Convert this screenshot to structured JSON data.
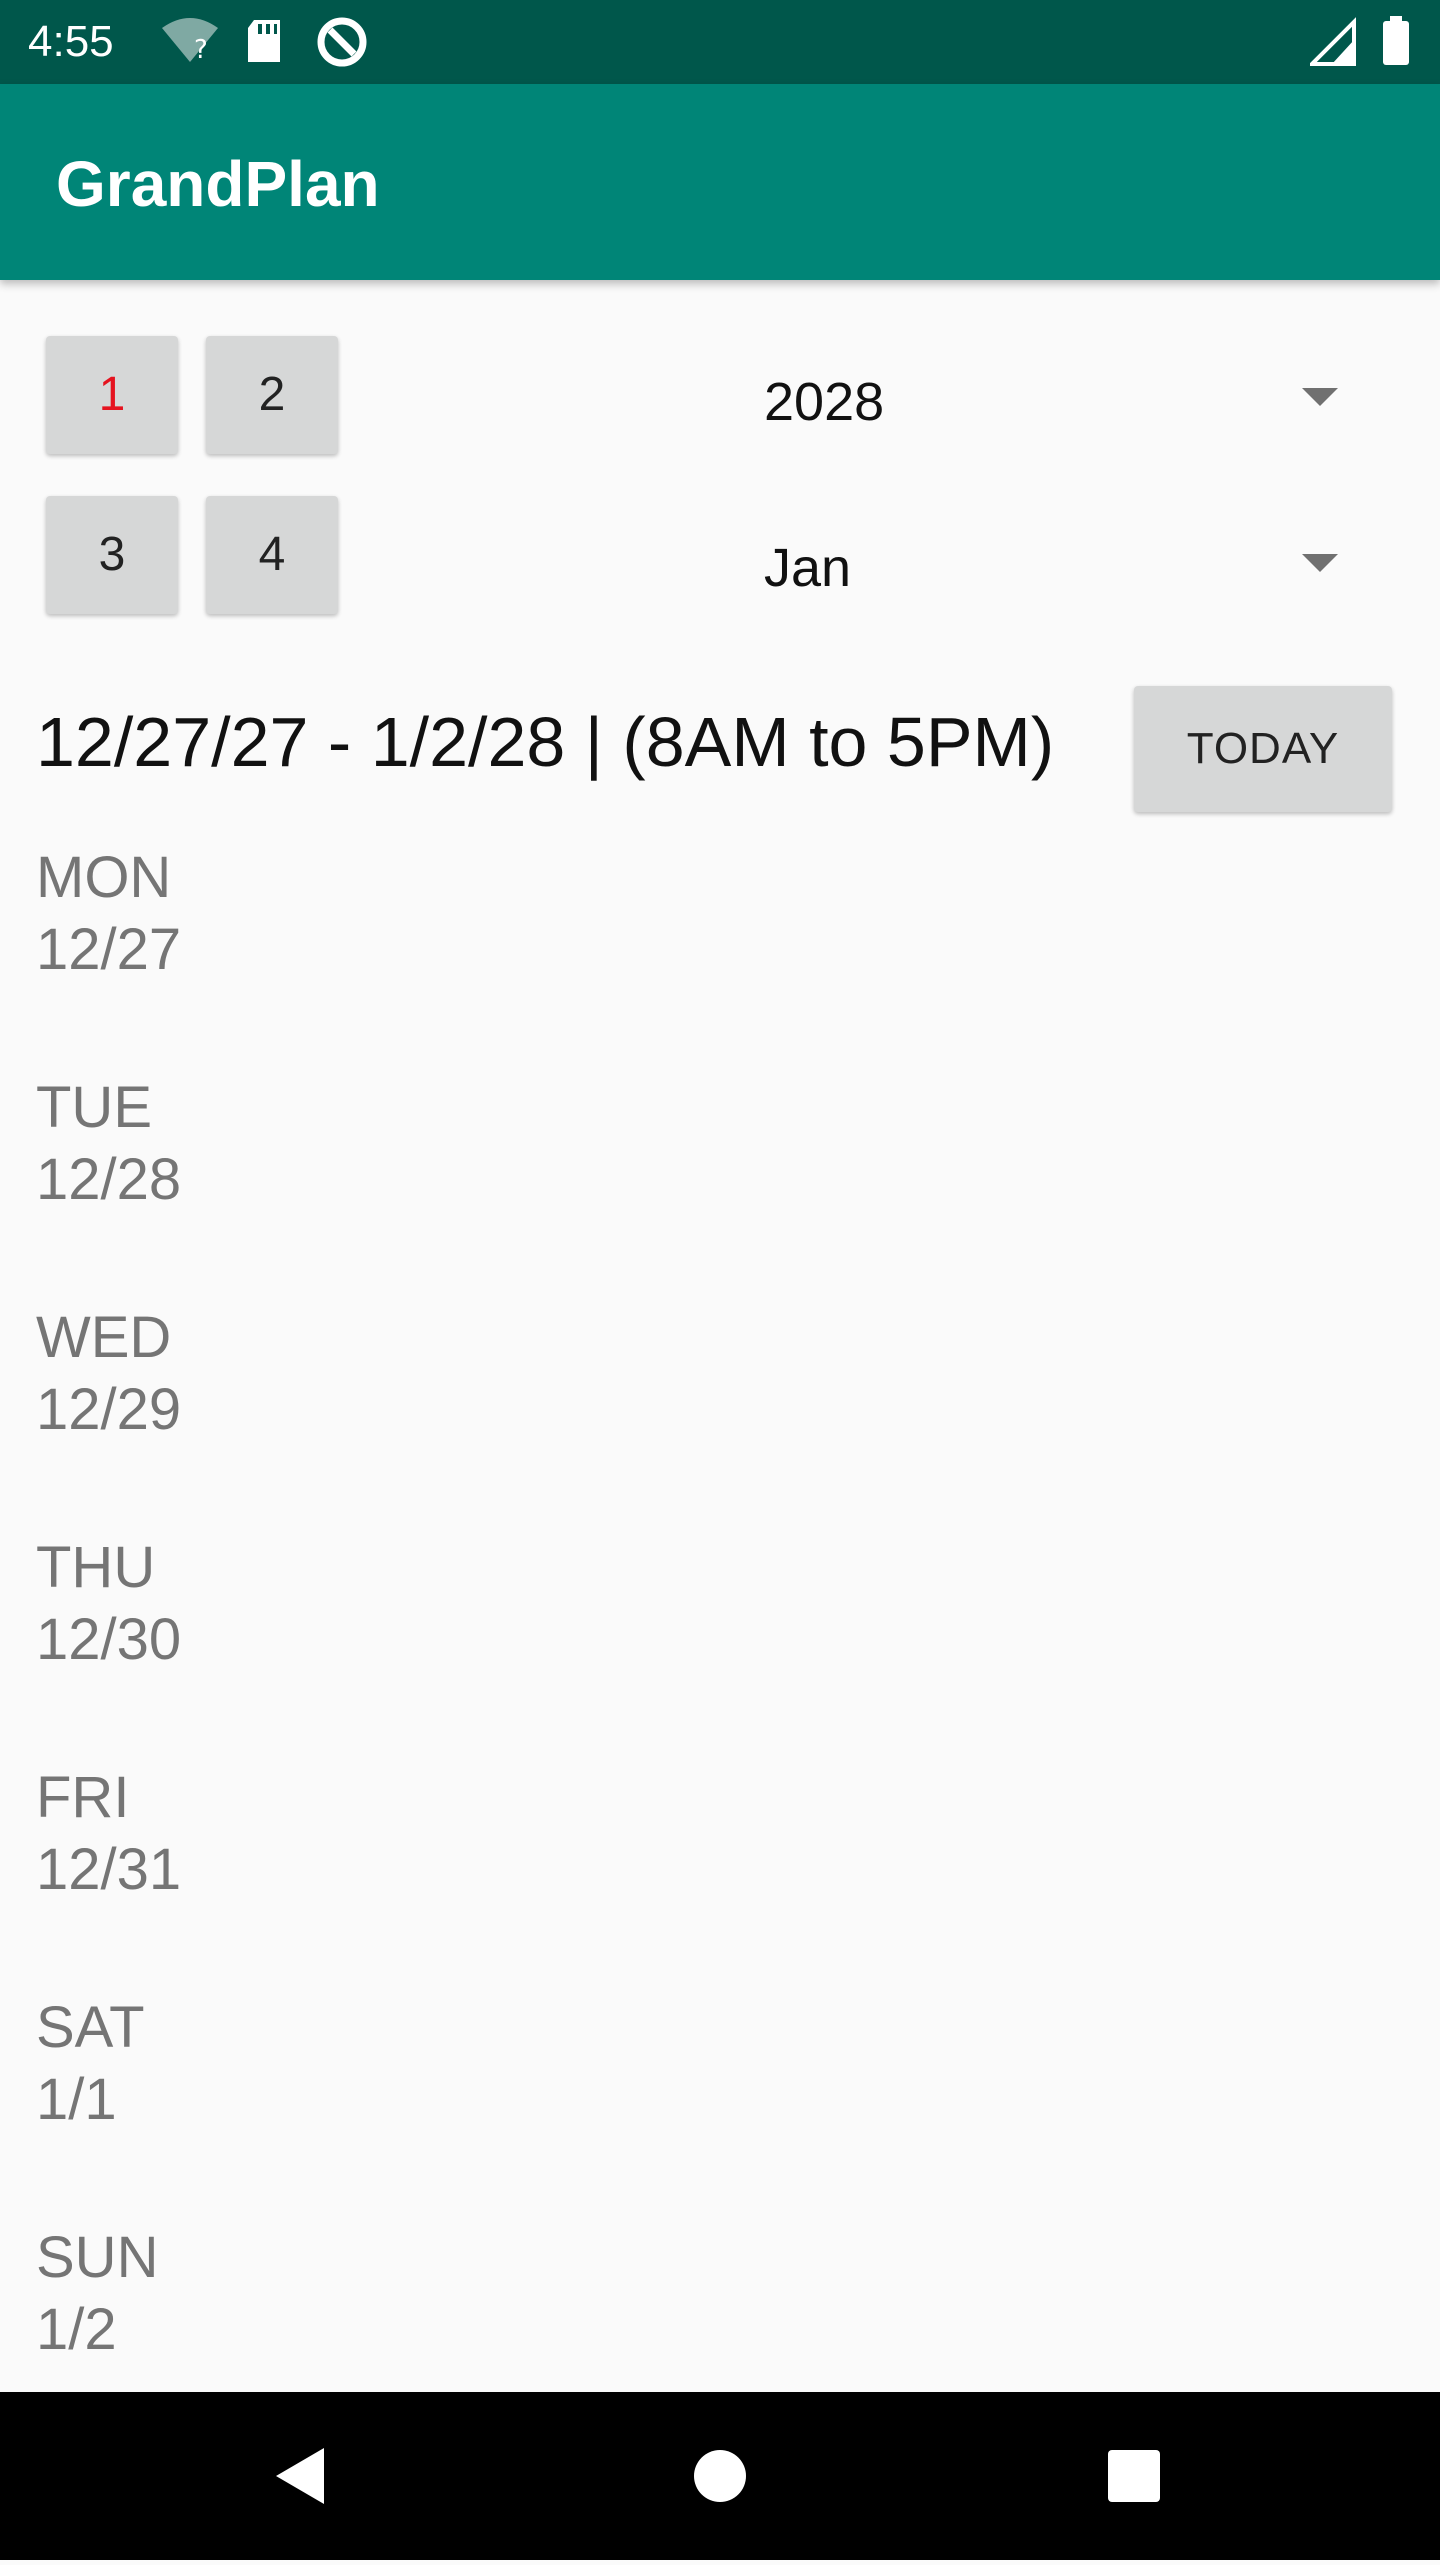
{
  "status_bar": {
    "time": "4:55",
    "icons": [
      "wifi-question-icon",
      "sd-card-icon",
      "sync-icon",
      "signal-icon",
      "battery-icon"
    ]
  },
  "app_bar": {
    "title": "GrandPlan",
    "color": "#008577"
  },
  "number_buttons": [
    {
      "label": "1",
      "active": true
    },
    {
      "label": "2",
      "active": false
    },
    {
      "label": "3",
      "active": false
    },
    {
      "label": "4",
      "active": false
    }
  ],
  "year_spinner": {
    "value": "2028"
  },
  "month_spinner": {
    "value": "Jan"
  },
  "range": {
    "text": "12/27/27 - 1/2/28 | (8AM to 5PM)"
  },
  "today_button": {
    "label": "TODAY"
  },
  "days": [
    {
      "name": "MON",
      "date": "12/27"
    },
    {
      "name": "TUE",
      "date": "12/28"
    },
    {
      "name": "WED",
      "date": "12/29"
    },
    {
      "name": "THU",
      "date": "12/30"
    },
    {
      "name": "FRI",
      "date": "12/31"
    },
    {
      "name": "SAT",
      "date": "1/1"
    },
    {
      "name": "SUN",
      "date": "1/2"
    }
  ],
  "nav": {
    "buttons": [
      "back-icon",
      "home-icon",
      "recents-icon"
    ]
  },
  "colors": {
    "accent_red": "#e5131f",
    "status_bar": "#00574b"
  }
}
